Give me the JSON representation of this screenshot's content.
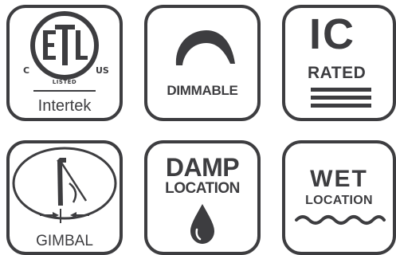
{
  "colors": {
    "ink": "#3d3d40",
    "background": "#ffffff"
  },
  "etl": {
    "mark_letters": "ETL",
    "left_mark": "C",
    "right_mark": "US",
    "ring_text": "LISTED",
    "brand": "Intertek"
  },
  "dimmable": {
    "label": "DIMMABLE",
    "icon": "half-arc-icon"
  },
  "ic_rated": {
    "letters": "IC",
    "label": "RATED",
    "icon": "insulation-bars-icon"
  },
  "gimbal": {
    "label": "GIMBAL",
    "icon": "gimbal-angle-icon"
  },
  "damp": {
    "line1": "DAMP",
    "line2": "LOCATION",
    "icon": "water-drop-icon"
  },
  "wet": {
    "line1": "WET",
    "line2": "LOCATION",
    "icon": "water-waves-icon"
  }
}
